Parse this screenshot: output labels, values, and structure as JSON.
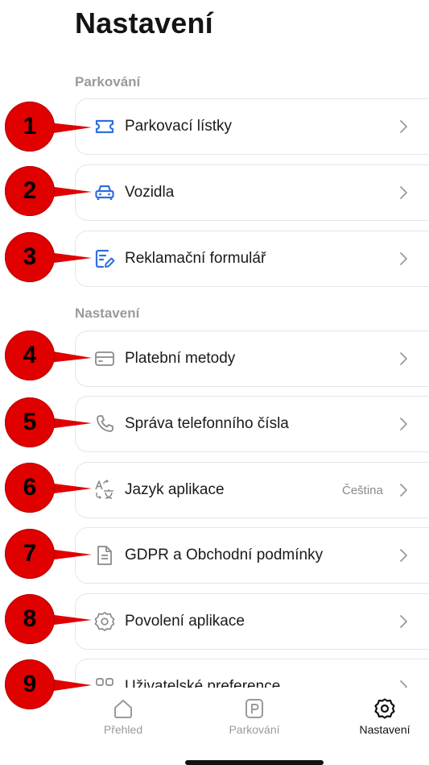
{
  "header": {
    "title": "Nastavení"
  },
  "sections": [
    {
      "label": "Parkování"
    },
    {
      "label": "Nastavení"
    }
  ],
  "items": [
    {
      "label": "Parkovací lístky",
      "icon": "ticket-icon"
    },
    {
      "label": "Vozidla",
      "icon": "car-icon"
    },
    {
      "label": "Reklamační formulář",
      "icon": "edit-form-icon"
    },
    {
      "label": "Platební metody",
      "icon": "credit-card-icon"
    },
    {
      "label": "Správa telefonního čísla",
      "icon": "phone-icon"
    },
    {
      "label": "Jazyk aplikace",
      "icon": "translate-icon",
      "value": "Čeština"
    },
    {
      "label": "GDPR a Obchodní podmínky",
      "icon": "document-icon"
    },
    {
      "label": "Povolení aplikace",
      "icon": "gear-icon"
    },
    {
      "label": "Uživatelské preference",
      "icon": "grid-icon"
    }
  ],
  "annotations": [
    "1",
    "2",
    "3",
    "4",
    "5",
    "6",
    "7",
    "8",
    "9"
  ],
  "tabbar": {
    "tabs": [
      {
        "label": "Přehled",
        "icon": "home-icon"
      },
      {
        "label": "Parkování",
        "icon": "parking-icon"
      },
      {
        "label": "Nastavení",
        "icon": "gear-icon",
        "active": true
      }
    ]
  },
  "colors": {
    "accent": "#2f6fe0",
    "muted": "#9a9a9a",
    "annotation": "#e00000"
  }
}
